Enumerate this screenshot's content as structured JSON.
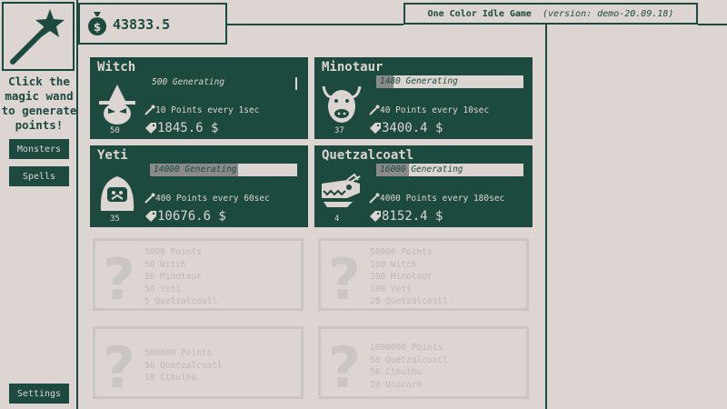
{
  "sidebar": {
    "hint": [
      "Click the",
      "magic wand",
      "to generate",
      "points!"
    ],
    "buttons": {
      "monsters": "Monsters",
      "spells": "Spells",
      "settings": "Settings"
    }
  },
  "header": {
    "points": "43833.5",
    "game_title": "One Color Idle Game",
    "version": "(version: demo-20.09.18)"
  },
  "monsters": [
    {
      "name": "Witch",
      "generating": "500 Generating",
      "gen_progress": 0.0,
      "rate": "10 Points every 1sec",
      "cost": "1845.6 $",
      "count": "50"
    },
    {
      "name": "Minotaur",
      "generating": "1480 Generating",
      "gen_progress": 0.12,
      "rate": "40 Points every 10sec",
      "cost": "3400.4 $",
      "count": "37"
    },
    {
      "name": "Yeti",
      "generating": "14000 Generating",
      "gen_progress": 0.6,
      "rate": "400 Points every 60sec",
      "cost": "10676.6 $",
      "count": "35"
    },
    {
      "name": "Quetzalcoatl",
      "generating": "16000 Generating",
      "gen_progress": 0.22,
      "rate": "4000 Points every 180sec",
      "cost": "8152.4 $",
      "count": "4"
    }
  ],
  "locked": [
    {
      "reqs": [
        "5000 Points",
        "50 Witch",
        "50 Minotaur",
        "50 Yeti",
        "5 Quetzalcoatl"
      ]
    },
    {
      "reqs": [
        "50000 Points",
        "100 Witch",
        "100 Minotaur",
        "100 Yeti",
        "20 Quetzalcoatl"
      ]
    },
    {
      "reqs": [
        "500000 Points",
        "50 Quetzalcoatl",
        "10 Cthulhu"
      ]
    },
    {
      "reqs": [
        "1000000 Points",
        "50 Quetzalcoatl",
        "50 Cthulhu",
        "10 Unicorn"
      ]
    }
  ],
  "colors": {
    "primary": "#1c4a3f",
    "background": "#ddd5d1",
    "locked": "#c9c6c3",
    "progress": "#8a8a8a"
  },
  "icons": {
    "wand": "magic-wand-icon",
    "coin": "coin-icon",
    "tag": "price-tag-icon",
    "question": "question-mark-icon"
  }
}
